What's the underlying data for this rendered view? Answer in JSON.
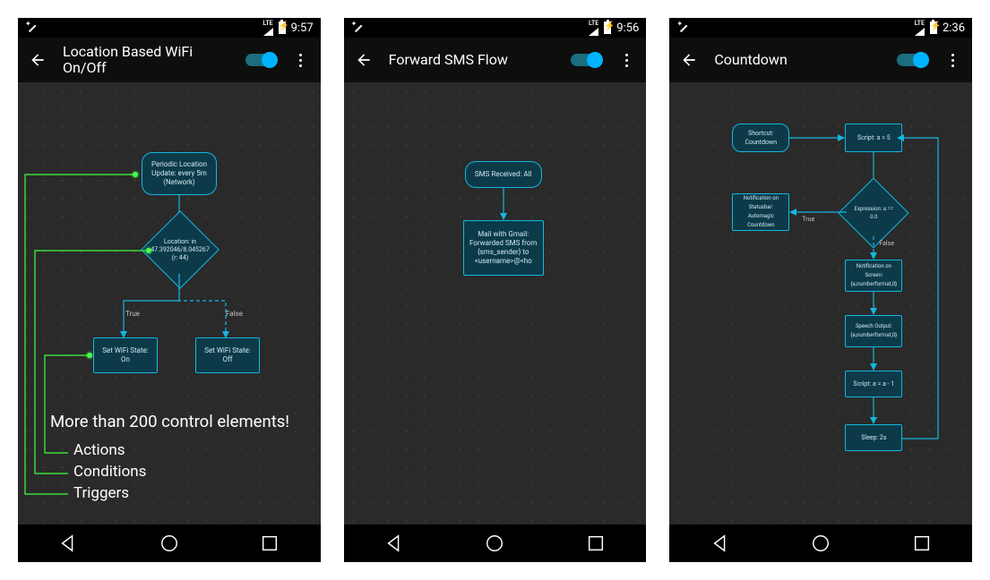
{
  "screens": [
    {
      "time": "9:57",
      "title": "Location Based WiFi On/Off",
      "trigger": "Periodic Location Update: every 5m (Network)",
      "condition": "Location: in 47.392046/8.045267 (r: 44)",
      "true_label": "True",
      "false_label": "False",
      "action_true": "Set WiFi State: On",
      "action_false": "Set WiFi State: Off",
      "overlay_heading": "More than 200 control elements!",
      "overlay_items": [
        "Actions",
        "Conditions",
        "Triggers"
      ]
    },
    {
      "time": "9:56",
      "title": "Forward SMS Flow",
      "trigger": "SMS Received: All",
      "action": "Mail with Gmail: Forwarded SMS from {sms_sender} to <username>@<ho"
    },
    {
      "time": "2:36",
      "title": "Countdown",
      "n1": "Shortcut: Countdown",
      "n2": "Script: a = 5",
      "n3": "Notification on Statusbar: Automagic Countdown",
      "cond": "Expression: a == 0.0",
      "true_label": "True",
      "false_label": "False",
      "n5": "Notification on Screen: {a,numberformat,0}",
      "n6": "Speech Output: {a,numberformat,0}",
      "n7": "Script: a = a - 1",
      "n8": "Sleep: 2s"
    }
  ]
}
